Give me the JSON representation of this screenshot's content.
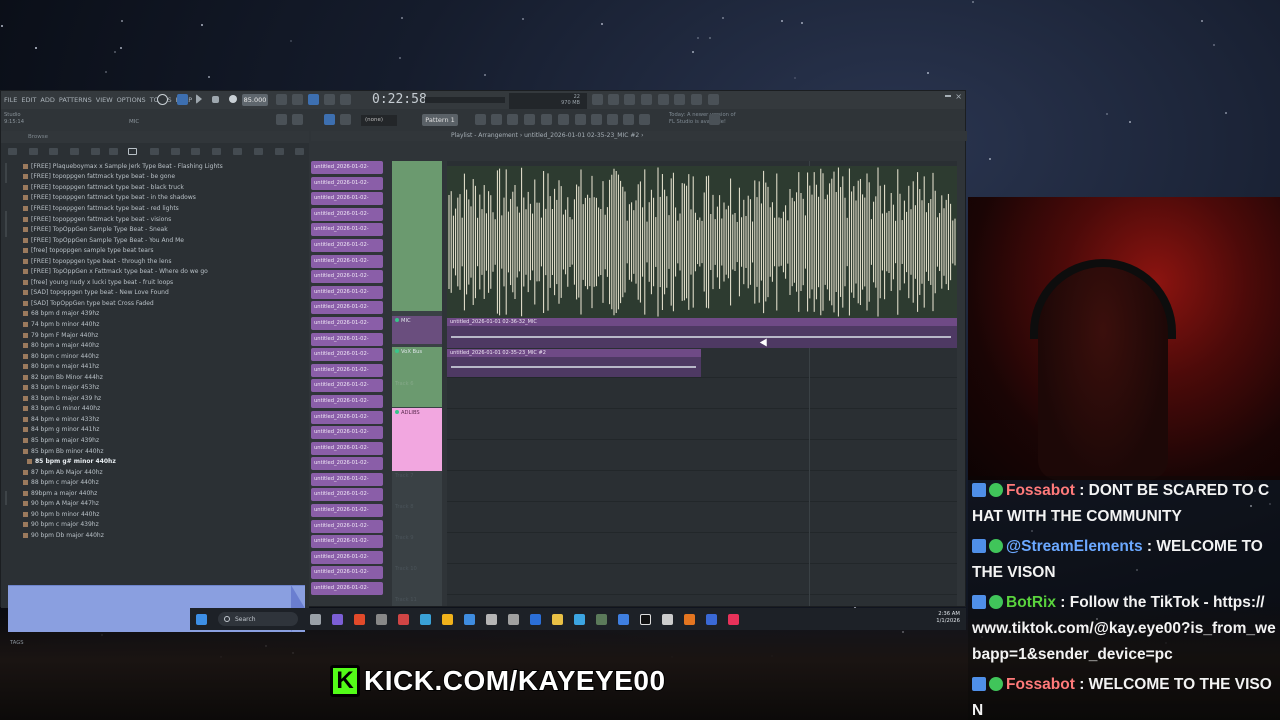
{
  "fl": {
    "menu": [
      "FILE",
      "EDIT",
      "ADD",
      "PATTERNS",
      "VIEW",
      "OPTIONS",
      "TOOLS",
      "HELP"
    ],
    "tempo": "85.000",
    "time": "0:22:58",
    "pattern": "Pattern 1",
    "snap": "(none)",
    "mic_label": "MIC",
    "hint_line1": "Studio",
    "hint_line2": "9:15:14",
    "news_line1": "Today: A newer version of",
    "news_line2": "FL Studio is available!",
    "cpu": "22",
    "mem": "970 MB",
    "mem2": "0",
    "playlist_title": "Playlist - Arrangement › untitled_2026-01-01 02-35-23_MIC #2 ›"
  },
  "browser": {
    "header": "Browse",
    "tags": "TAGS",
    "files": [
      "[FREE] Plaqueboymax x Sample Jerk Type Beat - Flashing Lights",
      "[FREE] topoppgen fattmack type beat - be gone",
      "[FREE] topoppgen fattmack type beat - black truck",
      "[FREE] topoppgen fattmack type beat - in the shadows",
      "[FREE] topoppgen fattmack type beat - red lights",
      "[FREE] topoppgen fattmack type beat - visions",
      "[FREE] TopOppGen Sample Type Beat - Sneak",
      "[FREE] TopOppGen Sample Type Beat - You And Me",
      "[free] topoppgen sample type beat tears",
      "[FREE] topoppgen type beat - through the lens",
      "[FREE] TopOppGen x Fattmack type beat - Where do we go",
      "[free] young nudy x lucki type beat - fruit loops",
      "[SAD] topoppgen type beat - New Love Found",
      "[SAD] TopOppGen type beat Cross Faded",
      "68 bpm d major 439hz",
      "74 bpm b minor 440hz",
      "79 bpm F Major 440hz",
      "80 bpm a major 440hz",
      "80 bpm c minor 440hz",
      "80 bpm e major 441hz",
      "82 bpm Bb Minor 444hz",
      "83 bpm b major 453hz",
      "83 bpm b major 439 hz",
      "83 bpm G minor 440hz",
      "84 bpm e minor 433hz",
      "84 bpm g minor 441hz",
      "85 bpm a major 439hz",
      "85 bpm Bb minor 440hz",
      "85 bpm g# minor 440hz",
      "87 bpm Ab Major 440hz",
      "88 bpm c major 440hz",
      "89bpm a major 440hz",
      "90 bpm A Major 447hz",
      "90 bpm b minor 440hz",
      "90 bpm c major 439hz",
      "90 bpm Db major 440hz"
    ]
  },
  "playlist": {
    "pattern_label": "untitled_2026-01-02-",
    "tracks": {
      "mic": "MIC",
      "vox_bus": "VoX Bus",
      "track6": "Track 6",
      "adlibs": "ADLIBS",
      "track_labels": [
        "Track 7",
        "Track 8",
        "Track 9",
        "Track 10",
        "Track 11"
      ]
    },
    "clip_mic": "untitled_2026-01-01 02-36-32_MIC",
    "clip_vox": "untitled_2026-01-01 02-35-23_MIC #2"
  },
  "taskbar": {
    "search": "Search",
    "time": "2:36 AM",
    "date": "1/1/2026"
  },
  "chat": [
    {
      "user": "Fossabot",
      "color": "#ff7a7a",
      "text": " : DONT BE SCARED TO CHAT WITH THE COMMUNITY"
    },
    {
      "user": "@StreamElements",
      "color": "#6ba8ff",
      "text": " : WELCOME TO THE VISON"
    },
    {
      "user": "BotRix",
      "color": "#5ad33d",
      "text": " : Follow the TikTok - https://www.tiktok.com/@kay.eye00?is_from_webapp=1&sender_device=pc"
    },
    {
      "user": "Fossabot",
      "color": "#ff7a7a",
      "text": " : WELCOME TO THE VISON"
    }
  ],
  "banner": {
    "logo": "K",
    "text": "KICK.COM/KAYEYE00"
  },
  "colors": {
    "kick_green": "#53fc18",
    "pattern_purple": "#8a5ea8",
    "adlibs_pink": "#f2a7e0",
    "track_green": "#6b9a6f"
  }
}
